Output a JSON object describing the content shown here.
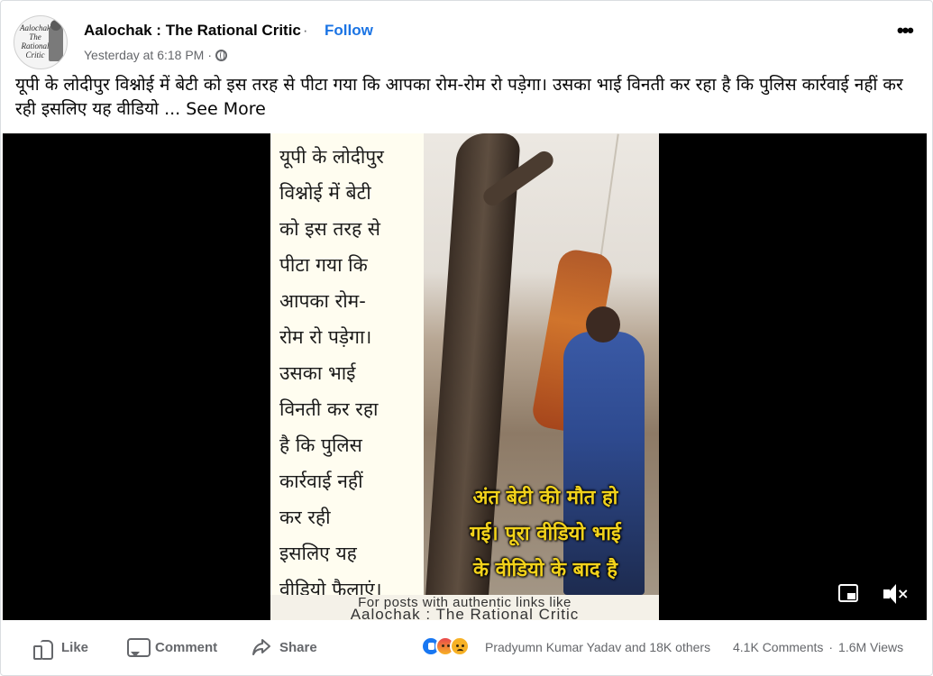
{
  "post": {
    "page_name": "Aalochak : The Rational Critic",
    "separator": "·",
    "follow_label": "Follow",
    "timestamp": "Yesterday at 6:18 PM",
    "meta_separator": "·",
    "privacy_icon": "globe-icon",
    "more_icon": "more-options-icon",
    "more_label": "•••",
    "caption": "यूपी के लोदीपुर विश्नोई में बेटी को इस तरह से पीटा गया कि आपका रोम-रोम रो पड़ेगा। उसका भाई विनती कर रहा है कि पुलिस कार्रवाई नहीं कर रही इसलिए यह वीडियो",
    "see_more": "... See More",
    "avatar": {
      "text": "Aalochak The Rational Critic"
    }
  },
  "video": {
    "panel_text": "यूपी के लोदीपुर\nविश्नोई में बेटी\nको इस तरह से\nपीटा गया कि\nआपका रोम-\nरोम रो पड़ेगा।\nउसका भाई\nविनती कर रहा\nहै कि पुलिस\nकार्रवाई नहीं\nकर रही\nइसलिए यह\nवीडियो फैलाएं।",
    "overlay_text": "अंत बेटी की मौत हो\nगई। पूरा वीडियो भाई\nके वीडियो के बाद है",
    "banner_line1": "For posts with authentic links like",
    "banner_line2": "Aalochak : The Rational Critic",
    "pip_icon": "picture-in-picture-icon",
    "mute_icon": "muted-speaker-icon",
    "mute_glyph": "×"
  },
  "actions": {
    "like_label": "Like",
    "comment_label": "Comment",
    "share_label": "Share"
  },
  "engagement": {
    "reactions": [
      "like",
      "angry",
      "sad"
    ],
    "reacted_by": "Pradyumn Kumar Yadav and 18K others",
    "comments": "4.1K Comments",
    "separator": "·",
    "views": "1.6M Views"
  },
  "colors": {
    "accent": "#1b74e4",
    "secondary_text": "#65676b",
    "overlay_text": "#f2d21b"
  }
}
